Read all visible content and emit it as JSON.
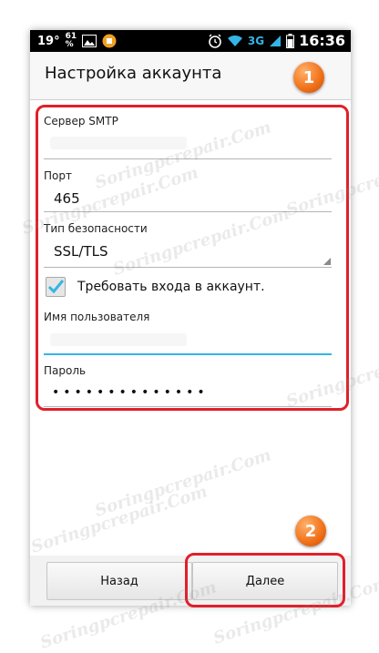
{
  "status_bar": {
    "temperature": "19°",
    "battery_percent_top": "61",
    "battery_percent_bottom": "%",
    "network": "3G",
    "time": "16:36",
    "icons": [
      "image-icon",
      "notification-app-icon",
      "alarm-clock-icon",
      "wifi-icon",
      "signal-icon",
      "battery-icon"
    ]
  },
  "header": {
    "title": "Настройка аккаунта"
  },
  "form": {
    "smtp_label": "Сервер SMTP",
    "smtp_value": "",
    "port_label": "Порт",
    "port_value": "465",
    "security_label": "Тип безопасности",
    "security_value": "SSL/TLS",
    "require_login_label": "Требовать входа в аккаунт.",
    "require_login_checked": true,
    "username_label": "Имя пользователя",
    "username_value": "",
    "password_label": "Пароль",
    "password_value": "••••••••••••••"
  },
  "buttons": {
    "back": "Назад",
    "next": "Далее"
  },
  "annotations": {
    "step1": "1",
    "step2": "2"
  },
  "watermark": "Soringpcrepair.Com",
  "colors": {
    "highlight": "#e0202a",
    "badge": "#f07018",
    "accent": "#33b5e5"
  }
}
